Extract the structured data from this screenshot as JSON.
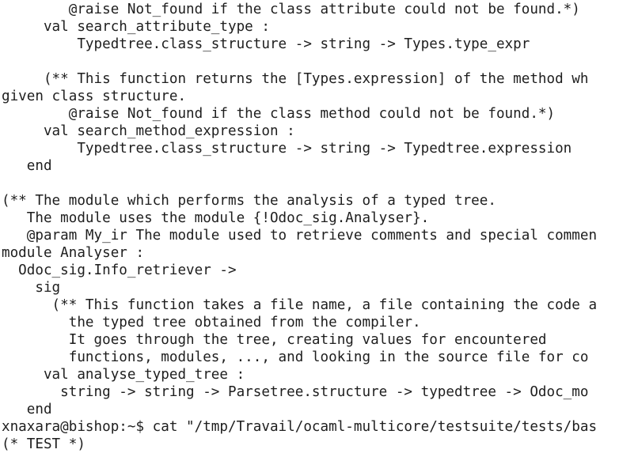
{
  "terminal": {
    "lines": [
      "        @raise Not_found if the class attribute could not be found.*)",
      "     val search_attribute_type :",
      "         Typedtree.class_structure -> string -> Types.type_expr",
      "",
      "     (** This function returns the [Types.expression] of the method wh",
      "given class structure.",
      "        @raise Not_found if the class method could not be found.*)",
      "     val search_method_expression :",
      "         Typedtree.class_structure -> string -> Typedtree.expression",
      "   end",
      "",
      "(** The module which performs the analysis of a typed tree.",
      "   The module uses the module {!Odoc_sig.Analyser}.",
      "   @param My_ir The module used to retrieve comments and special commen",
      "module Analyser :",
      "  Odoc_sig.Info_retriever ->",
      "    sig",
      "      (** This function takes a file name, a file containing the code a",
      "        the typed tree obtained from the compiler.",
      "        It goes through the tree, creating values for encountered",
      "        functions, modules, ..., and looking in the source file for co",
      "     val analyse_typed_tree :",
      "       string -> string -> Parsetree.structure -> typedtree -> Odoc_mo",
      "   end",
      "xnaxara@bishop:~$ cat \"/tmp/Travail/ocaml-multicore/testsuite/tests/bas",
      "(* TEST *)"
    ]
  },
  "colors": {
    "background": "#ffffff",
    "foreground": "#1e1e1e"
  }
}
